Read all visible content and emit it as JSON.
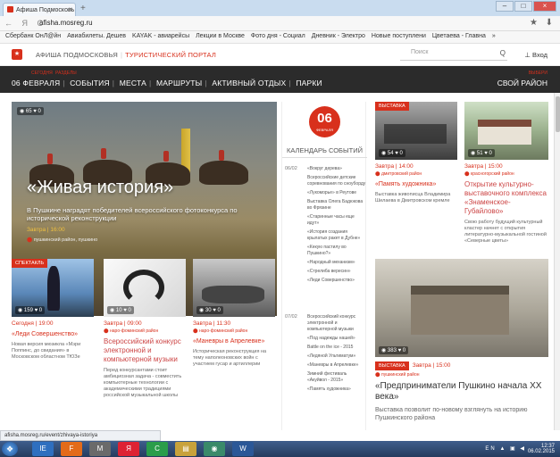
{
  "browser": {
    "tab_label": "Афиша Подмосковь",
    "tab_close": "×",
    "new_tab": "+",
    "nav_glyphs": "← Я C",
    "url": "afisha.mosreg.ru",
    "star": "★",
    "download": "⬇",
    "bookmarks": [
      "Сбербанк ОнЛ@йн",
      "Авиабилеты. Дешев",
      "KAYAK - авиарейсы",
      "Лекции в Москве",
      "Фото дня - Социал",
      "Дневник - Электро",
      "Новые поступлени",
      "Цветаева - Главна",
      "»"
    ],
    "status_url": "afisha.mosreg.ru/event/zhivaya-istoriya"
  },
  "site": {
    "logo_glyph": "★",
    "name": "АФИША ПОДМОСКОВЬЯ",
    "separator": "|",
    "portal": "ТУРИСТИЧЕСКИЙ ПОРТАЛ",
    "search_placeholder": "Поиск",
    "search_glyph": "Q",
    "login": "Вход",
    "login_glyph": "⊥"
  },
  "nav": {
    "small_today": "СЕГОДНЯ",
    "small_sections": "РАЗДЕЛЫ",
    "date": "06 ФЕВРАЛЯ",
    "items": [
      "СОБЫТИЯ",
      "МЕСТА",
      "МАРШРУТЫ",
      "АКТИВНЫЙ ОТДЫХ",
      "ПАРКИ"
    ],
    "region_small": "ВЫБЕРИ",
    "region": "СВОЙ РАЙОН"
  },
  "hero": {
    "stats": "◉ 65  ♥ 0",
    "title": "«Живая история»",
    "desc": "В Пушкине наградят победителей всероссийского фотоконкурса по исторической реконструкции",
    "when": "Завтра | 16:00",
    "where": "пушкинский район, пушкино"
  },
  "cards": [
    {
      "badge": "СПЕКТАКЛЬ",
      "stats": "◉ 159  ♥ 0",
      "when": "Сегодня | 19:00",
      "where": "",
      "title": "«Леди Совершенство»",
      "text": "Новая версия мюзикла «Мэри Поппинс, до свидания» в Московском областном ТЮЗе"
    },
    {
      "badge": "",
      "stats": "◉ 10  ♥ 0",
      "when": "Завтра | 09:00",
      "where": "наро-фоминский район",
      "title": "Всероссийский конкурс электронной и компьютерной музыки",
      "text": "Перед конкурсантами стоит амбициозная задача - совместить компьютерные технологии с академическими традициями российской музыкальной школы"
    },
    {
      "badge": "",
      "stats": "◉ 30  ♥ 0",
      "when": "Завтра | 11:30",
      "where": "наро-фоминский район",
      "title": "«Маневры в Апрелевке»",
      "text": "Историческая реконструкция на тему наполеоновских войн с участием гусар и артиллерии"
    }
  ],
  "calendar": {
    "day": "06",
    "month": "ФЕВРАЛЯ",
    "title": "КАЛЕНДАРЬ СОБЫТИЙ",
    "days": [
      {
        "label": "06/02",
        "events": [
          "«Вокруг дерева»",
          "Всероссийские детские соревнования по сноуборду",
          "«Лукоморье» в Реутове",
          "Выставка Олега Бадюкова во Фрязине",
          "«Старинные часы еще идут»",
          "«История создания крылатых ракет в Дубне»",
          "«Кекую пастилу во Пушкино?»",
          "«Народный механизм»",
          "«Стрелиба вересин»",
          "«Леди Совершенство»"
        ]
      },
      {
        "label": "07/02",
        "events": [
          "Всероссийский конкурс электронной и компьютерной музыки",
          "«Под надежды нашей»",
          "Battle on the ice - 2015",
          "«Ледяной Ультиматум»",
          "«Маневры в Апрелевке»",
          "Зимний фестиваль «Акуйвол - 2015»",
          "«Память художника»"
        ]
      }
    ]
  },
  "right": {
    "top_left": {
      "badge": "ВЫСТАВКА",
      "stats": "◉ 54  ♥ 0",
      "when": "Завтра | 14:00",
      "where": "дмитровский район",
      "title": "«Память художника»",
      "text": "Выставка живописца Владимира Шилаева в Дмитровском кремле"
    },
    "top_right": {
      "badge": "",
      "stats": "◉ 51  ♥ 0",
      "when": "Завтра | 15:00",
      "where": "красногорский район",
      "title": "Открытие культурно-выставочного комплекса «Знаменское-Губайлово»",
      "text": "Свою работу будущий культурный кластер начнет с открытия литературно-музыкальной гостиной «Северные цветы»"
    },
    "big": {
      "badge": "ВЫСТАВКА",
      "stats": "◉ 383  ♥ 0",
      "when": "Завтра | 15:00",
      "where": "пушкинский район",
      "title": "«Предприниматели Пушкино начала XX века»",
      "text": "Выставка позволит по-новому взглянуть на историю Пушкинского района"
    }
  },
  "taskbar": {
    "lang": "EN",
    "tray_icons": "▲ ▣ ◀",
    "time": "12:37",
    "date": "06.02.2015",
    "apps": [
      "IE",
      "F",
      "M",
      "Я",
      "C",
      "▤",
      "◉",
      "W"
    ]
  }
}
